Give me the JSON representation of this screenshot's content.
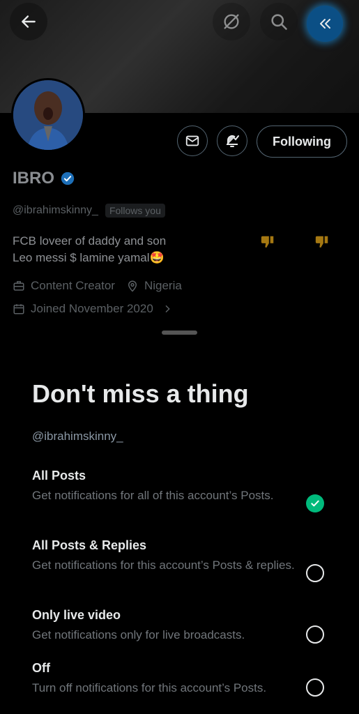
{
  "profile": {
    "name": "IBRO",
    "handle": "@ibrahimskinny_",
    "follows_you": "Follows you",
    "bio_line1": "FCB loveer of daddy and son",
    "bio_line2": "Leo messi $ lamine yamal🤩",
    "category": "Content Creator",
    "location": "Nigeria",
    "joined": "Joined November 2020",
    "following_label": "Following"
  },
  "sheet": {
    "title": "Don't miss a thing",
    "handle": "@ibrahimskinny_",
    "options": [
      {
        "title": "All Posts",
        "desc": "Get notifications for all of this account’s Posts.",
        "selected": true
      },
      {
        "title": "All Posts & Replies",
        "desc": "Get notifications for this account’s Posts & replies.",
        "selected": false
      },
      {
        "title": "Only live video",
        "desc": "Get notifications only for live broadcasts.",
        "selected": false
      },
      {
        "title": "Off",
        "desc": "Turn off notifications for this account’s Posts.",
        "selected": false
      }
    ]
  },
  "icons": {
    "back": "arrow-left-icon",
    "grok": "grok-icon",
    "search": "search-icon",
    "collapse": "double-chevron-left-icon",
    "message": "envelope-icon",
    "notifications": "bell-check-icon",
    "verified": "verified-badge-icon",
    "category": "briefcase-icon",
    "location": "location-pin-icon",
    "calendar": "calendar-icon"
  },
  "colors": {
    "accent": "#1d9bf0",
    "selected": "#00ba7c",
    "background": "#000000"
  }
}
